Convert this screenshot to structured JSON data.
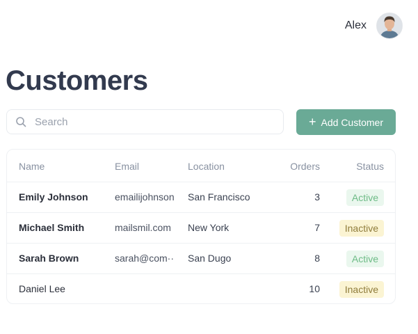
{
  "user": {
    "name": "Alex"
  },
  "page": {
    "title": "Customers"
  },
  "search": {
    "placeholder": "Search",
    "value": ""
  },
  "actions": {
    "add_label": "Add Customer"
  },
  "table": {
    "headers": {
      "name": "Name",
      "email": "Email",
      "location": "Location",
      "orders": "Orders",
      "status": "Status"
    },
    "rows": [
      {
        "name": "Emily Johnson",
        "email": "emailijohnson",
        "location": "San Francisco",
        "orders": "3",
        "status": "Active"
      },
      {
        "name": "Michael Smith",
        "email": "mailsmil.com",
        "location": "New York",
        "orders": "7",
        "status": "Inactive"
      },
      {
        "name": "Sarah Brown",
        "email": "sarah@com··",
        "location": "San Dugo",
        "orders": "8",
        "status": "Active"
      },
      {
        "name": "Daniel Lee",
        "email": "",
        "location": "",
        "orders": "10",
        "status": "Inactive"
      }
    ]
  },
  "colors": {
    "accent": "#6aaa96",
    "title": "#323a4e",
    "active_bg": "#eaf7ee",
    "active_fg": "#6dbb86",
    "inactive_bg": "#fbf4d3",
    "inactive_fg": "#8f7c3b"
  },
  "icons": {
    "search": "search-icon",
    "avatar": "avatar",
    "plus": "plus-icon"
  }
}
